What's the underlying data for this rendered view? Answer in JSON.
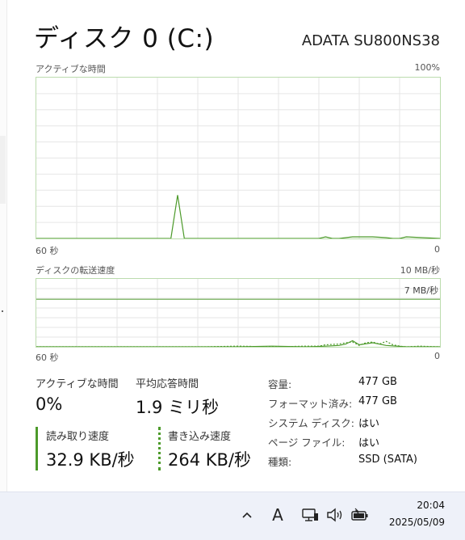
{
  "header": {
    "title": "ディスク 0 (C:)",
    "model": "ADATA SU800NS38"
  },
  "active_time_graph": {
    "label": "アクティブな時間",
    "max_label": "100%",
    "x_left_label": "60 秒",
    "x_right_label": "0"
  },
  "transfer_graph": {
    "label": "ディスクの転送速度",
    "max_label": "10 MB/秒",
    "marker_label": "7 MB/秒",
    "x_left_label": "60 秒",
    "x_right_label": "0"
  },
  "stats": {
    "active_time": {
      "label": "アクティブな時間",
      "value": "0%"
    },
    "avg_response": {
      "label": "平均応答時間",
      "value": "1.9 ミリ秒"
    },
    "read_speed": {
      "label": "読み取り速度",
      "value": "32.9 KB/秒"
    },
    "write_speed": {
      "label": "書き込み速度",
      "value": "264 KB/秒"
    }
  },
  "properties": [
    {
      "key": "容量:",
      "value": "477 GB"
    },
    {
      "key": "フォーマット済み:",
      "value": "477 GB"
    },
    {
      "key": "システム ディスク:",
      "value": "はい"
    },
    {
      "key": "ページ ファイル:",
      "value": "はい"
    },
    {
      "key": "種類:",
      "value": "SSD (SATA)"
    }
  ],
  "taskbar": {
    "time": "20:04",
    "date": "2025/05/09",
    "ime_label": "A",
    "icons": [
      "chevron-up-icon",
      "ime-icon",
      "network-icon",
      "speaker-icon",
      "battery-icon"
    ]
  },
  "colors": {
    "accent": "#4c9a2a",
    "graph_border": "#bcdcae",
    "grid": "#e6e6e6",
    "taskbar": "#eef1f9"
  },
  "chart_data": [
    {
      "type": "line",
      "title": "アクティブな時間",
      "xlabel": "",
      "ylabel": "",
      "x_range_seconds": [
        60,
        0
      ],
      "ylim": [
        0,
        100
      ],
      "grid": true,
      "series": [
        {
          "x": [
            60,
            45,
            43,
            42,
            41,
            40,
            39,
            38,
            37,
            36,
            35,
            30,
            25,
            20,
            18,
            17,
            16,
            15,
            14,
            13,
            10,
            8,
            7,
            6,
            5,
            0
          ],
          "values": [
            0,
            0,
            0,
            0,
            0,
            0,
            27,
            0,
            0,
            0,
            0,
            0,
            0,
            0,
            0,
            1,
            0,
            0,
            0.5,
            1,
            1,
            0.5,
            0,
            0,
            1,
            0
          ]
        }
      ]
    },
    {
      "type": "line",
      "title": "ディスクの転送速度",
      "xlabel": "",
      "ylabel": "",
      "x_range_seconds": [
        60,
        0
      ],
      "ylim": [
        0,
        10
      ],
      "grid": true,
      "series": [
        {
          "line_style": "solid",
          "x": [
            60,
            40,
            35,
            30,
            25,
            20,
            17,
            15,
            14,
            13,
            12,
            10,
            8,
            5,
            0
          ],
          "values": [
            0,
            0,
            0,
            0,
            0.1,
            0,
            0.1,
            0.2,
            0.4,
            0.9,
            0.3,
            0.6,
            0.2,
            0,
            0
          ]
        },
        {
          "line_style": "dotted",
          "x": [
            60,
            35,
            30,
            25,
            22,
            20,
            18,
            17,
            15,
            14,
            13,
            12,
            11,
            10,
            9,
            8,
            7,
            6,
            5,
            3,
            0
          ],
          "values": [
            0,
            0,
            0.1,
            0,
            0.05,
            0.1,
            0.1,
            0.3,
            0.4,
            0.6,
            0.7,
            0.2,
            0.6,
            0.7,
            0.4,
            0.8,
            0.3,
            0.1,
            0,
            0.1,
            0
          ]
        }
      ],
      "reference_line": 7
    }
  ]
}
